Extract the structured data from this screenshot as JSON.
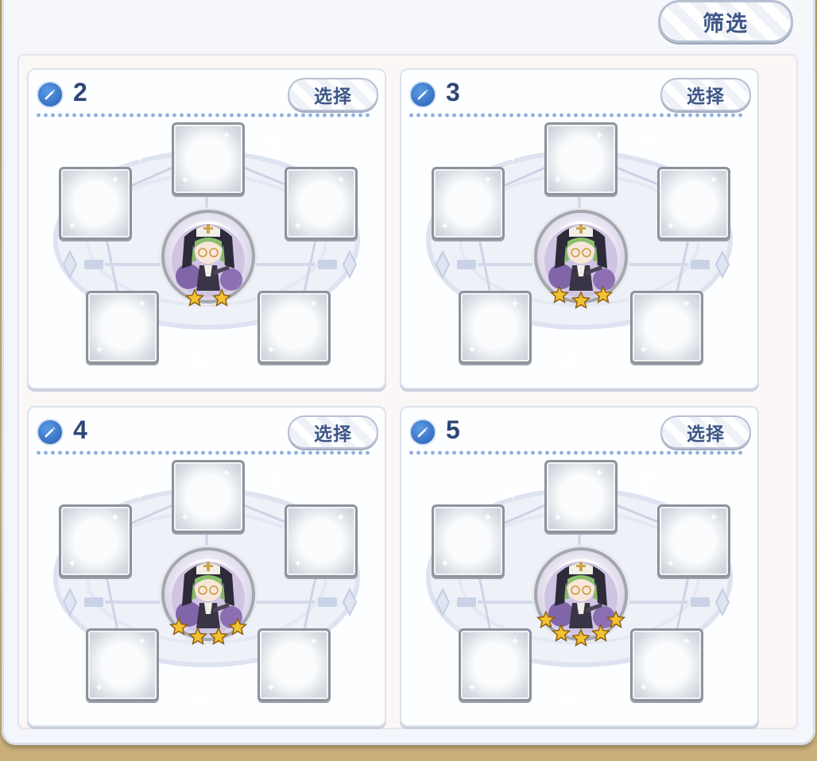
{
  "header": {
    "filter_label": "筛选"
  },
  "teams": [
    {
      "number": "2",
      "select_label": "选择",
      "stars": 2
    },
    {
      "number": "3",
      "select_label": "选择",
      "stars": 3
    },
    {
      "number": "4",
      "select_label": "选择",
      "stars": 4
    },
    {
      "number": "5",
      "select_label": "选择",
      "stars": 5
    }
  ],
  "icons": {
    "edit": "pencil-icon",
    "star": "star-icon",
    "character": "character-portrait"
  },
  "colors": {
    "accent_text": "#2e4677",
    "button_text": "#3d5686",
    "edit_icon": "#3a7bd5",
    "star": "#f2c230"
  }
}
